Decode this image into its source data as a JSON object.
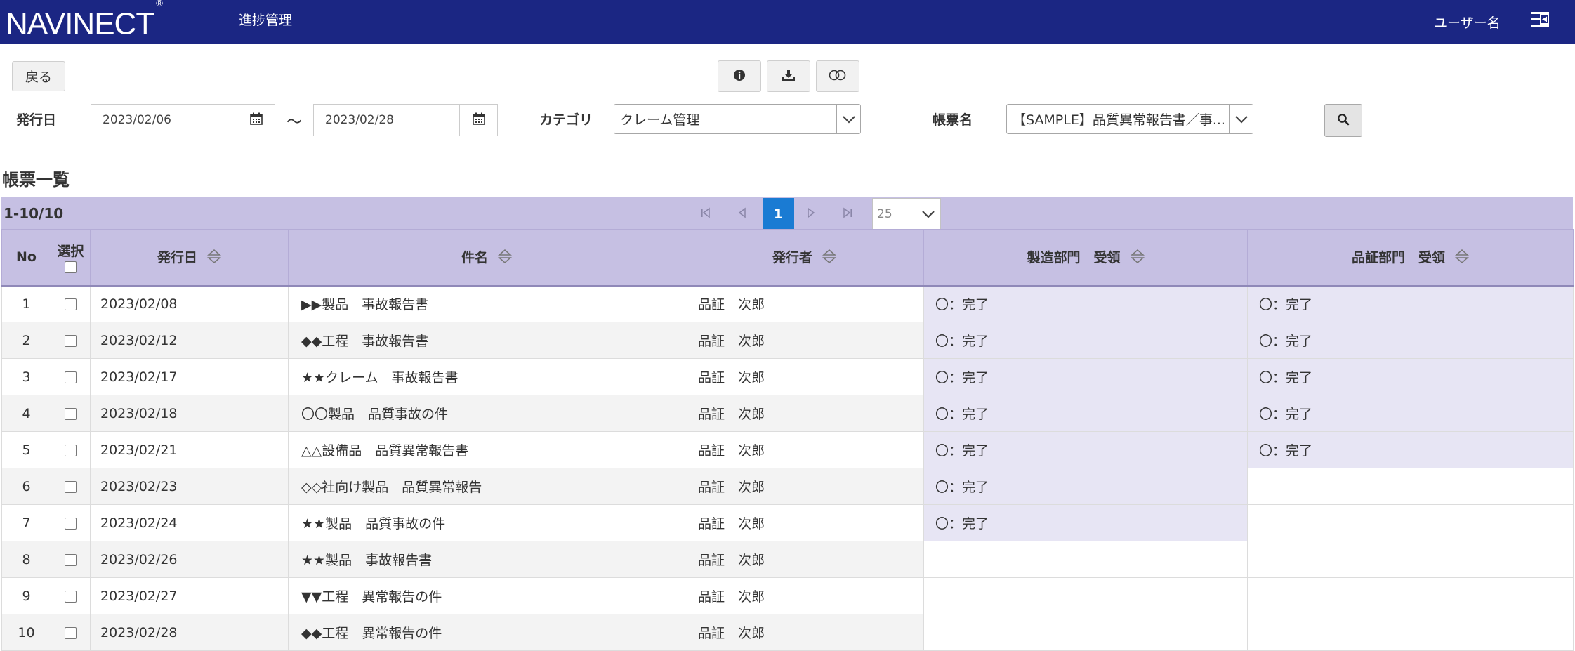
{
  "header": {
    "logo_text": "NAVINECT",
    "logo_mark": "®",
    "app_title": "進捗管理",
    "user_name": "ユーザー名",
    "menu_icon": "menu-icon"
  },
  "toolbar": {
    "back_label": "戻る",
    "info_icon": "info-icon",
    "download_icon": "download-icon",
    "toggle_icon": "toggle-icon"
  },
  "filters": {
    "issue_date_label": "発行日",
    "date_from": "2023/02/06",
    "range_sep": "～",
    "date_to": "2023/02/28",
    "category_label": "カテゴリ",
    "category_value": "クレーム管理",
    "form_label": "帳票名",
    "form_value": "【SAMPLE】品質異常報告書／事...",
    "search_icon": "search-icon"
  },
  "list": {
    "title": "帳票一覧",
    "count": "1-10/10",
    "current_page": "1",
    "page_size": "25"
  },
  "columns": {
    "no": "No",
    "select": "選択",
    "issue_date": "発行日",
    "title": "件名",
    "author": "発行者",
    "mfg": "製造部門　受領",
    "qa": "品証部門　受領"
  },
  "rows": [
    {
      "no": "1",
      "date": "2023/02/08",
      "title": "▶▶製品　事故報告書",
      "author": "品証　次郎",
      "mfg": "〇：完了",
      "qa": "〇：完了"
    },
    {
      "no": "2",
      "date": "2023/02/12",
      "title": "◆◆工程　事故報告書",
      "author": "品証　次郎",
      "mfg": "〇：完了",
      "qa": "〇：完了"
    },
    {
      "no": "3",
      "date": "2023/02/17",
      "title": "★★クレーム　事故報告書",
      "author": "品証　次郎",
      "mfg": "〇：完了",
      "qa": "〇：完了"
    },
    {
      "no": "4",
      "date": "2023/02/18",
      "title": "〇〇製品　品質事故の件",
      "author": "品証　次郎",
      "mfg": "〇：完了",
      "qa": "〇：完了"
    },
    {
      "no": "5",
      "date": "2023/02/21",
      "title": "△△設備品　品質異常報告書",
      "author": "品証　次郎",
      "mfg": "〇：完了",
      "qa": "〇：完了"
    },
    {
      "no": "6",
      "date": "2023/02/23",
      "title": "◇◇社向け製品　品質異常報告",
      "author": "品証　次郎",
      "mfg": "〇：完了",
      "qa": ""
    },
    {
      "no": "7",
      "date": "2023/02/24",
      "title": "★★製品　品質事故の件",
      "author": "品証　次郎",
      "mfg": "〇：完了",
      "qa": ""
    },
    {
      "no": "8",
      "date": "2023/02/26",
      "title": "★★製品　事故報告書",
      "author": "品証　次郎",
      "mfg": "",
      "qa": ""
    },
    {
      "no": "9",
      "date": "2023/02/27",
      "title": "▼▼工程　異常報告の件",
      "author": "品証　次郎",
      "mfg": "",
      "qa": ""
    },
    {
      "no": "10",
      "date": "2023/02/28",
      "title": "◆◆工程　異常報告の件",
      "author": "品証　次郎",
      "mfg": "",
      "qa": ""
    }
  ]
}
